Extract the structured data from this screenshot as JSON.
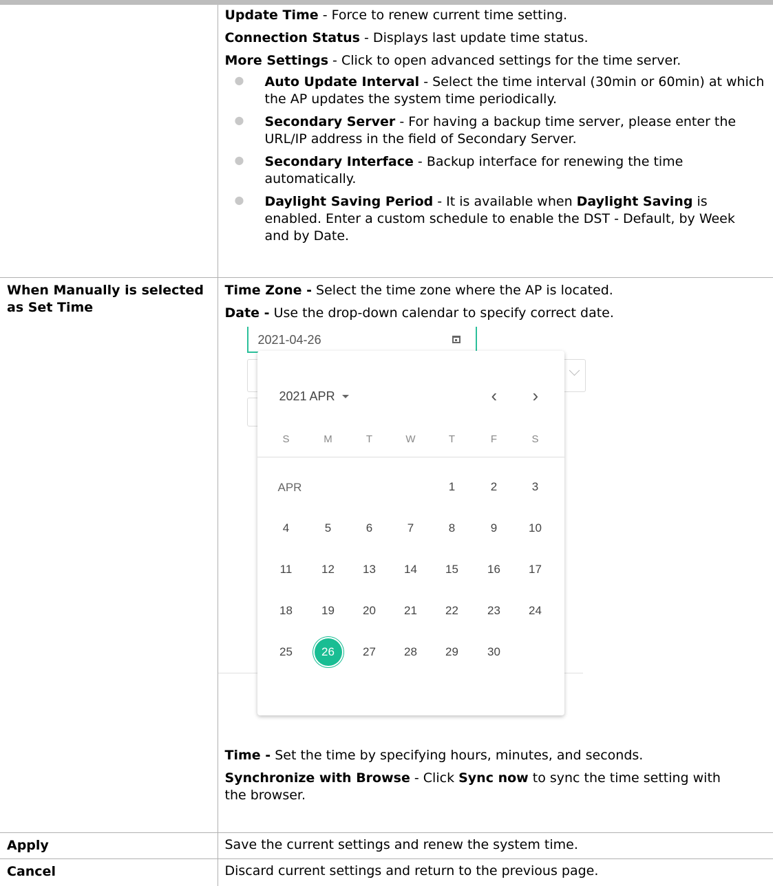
{
  "row1": {
    "items": [
      {
        "bold": "Update Time",
        "rest": " - Force to renew current time setting."
      },
      {
        "bold": "Connection Status",
        "rest": " - Displays last update time status."
      },
      {
        "bold": "More Settings",
        "rest": " - Click to open advanced settings for the time server."
      }
    ],
    "bullets": [
      {
        "bold": "Auto Update Interval",
        "rest": " - Select the time interval (30min or 60min) at which the AP updates the system time periodically."
      },
      {
        "bold": "Secondary Server",
        "rest": " - For having a backup time server, please enter the URL/IP address in the field of Secondary Server."
      },
      {
        "bold": "Secondary Interface",
        "rest": " - Backup interface for renewing the time automatically."
      },
      {
        "bold": "Daylight Saving Period",
        "rest_a": " - It is available when ",
        "bold2": "Daylight Saving",
        "rest_b": " is enabled. Enter a custom schedule to enable the DST - Default, by Week and by Date."
      }
    ]
  },
  "row2": {
    "label": "When Manually is selected as Set Time",
    "tz_bold": "Time Zone -",
    "tz_rest": " Select the time zone where the AP is located.",
    "date_bold": "Date -",
    "date_rest": " Use the drop-down calendar to specify correct date.",
    "time_bold": "Time -",
    "time_rest": " Set the time by specifying hours, minutes, and seconds.",
    "sync_bold": "Synchronize with Browse",
    "sync_mid": " - Click ",
    "sync_bold2": "Sync now",
    "sync_rest": " to sync the time setting with the browser."
  },
  "datepicker": {
    "value": "2021-04-26",
    "header": "2021 APR",
    "prev_icon": "chevron-left-icon",
    "next_icon": "chevron-right-icon",
    "weekdays": [
      "S",
      "M",
      "T",
      "W",
      "T",
      "F",
      "S"
    ],
    "month_label": "APR",
    "first_weekday": 4,
    "days_in_month": 30,
    "selected_day": 26,
    "accent": "#19bd93"
  },
  "row3": {
    "label": "Apply",
    "desc": "Save the current settings and renew the system time."
  },
  "row4": {
    "label": "Cancel",
    "desc": "Discard current settings and return to the previous page."
  }
}
